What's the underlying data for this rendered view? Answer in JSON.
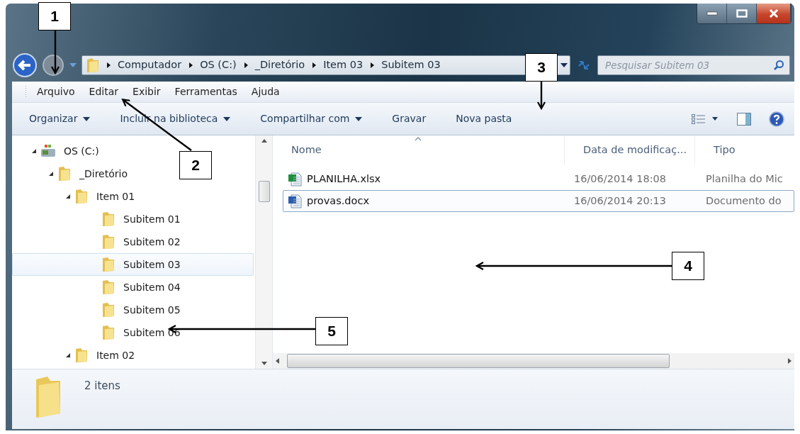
{
  "address_bar": {
    "breadcrumbs": [
      "Computador",
      "OS (C:)",
      "_Diretório",
      "Item 03",
      "Subitem 03"
    ]
  },
  "search": {
    "placeholder": "Pesquisar Subitem 03"
  },
  "menu": [
    {
      "label": "Arquivo"
    },
    {
      "label": "Editar"
    },
    {
      "label": "Exibir"
    },
    {
      "label": "Ferramentas"
    },
    {
      "label": "Ajuda"
    }
  ],
  "toolbar": [
    {
      "label": "Organizar",
      "dropdown": true
    },
    {
      "label": "Incluir na biblioteca",
      "dropdown": true
    },
    {
      "label": "Compartilhar com",
      "dropdown": true
    },
    {
      "label": "Gravar",
      "dropdown": false
    },
    {
      "label": "Nova pasta",
      "dropdown": false
    }
  ],
  "tree": [
    {
      "label": "OS (C:)",
      "kind": "drive",
      "expanded": true,
      "selected": false,
      "children": [
        {
          "label": "_Diretório",
          "kind": "folder",
          "expanded": true,
          "selected": false,
          "children": [
            {
              "label": "Item 01",
              "kind": "folder",
              "expanded": true,
              "selected": false,
              "children": [
                {
                  "label": "Subitem 01",
                  "kind": "folder",
                  "selected": false
                },
                {
                  "label": "Subitem 02",
                  "kind": "folder",
                  "selected": false
                },
                {
                  "label": "Subitem 03",
                  "kind": "folder",
                  "selected": true
                },
                {
                  "label": "Subitem 04",
                  "kind": "folder",
                  "selected": false
                },
                {
                  "label": "Subitem 05",
                  "kind": "folder",
                  "selected": false
                },
                {
                  "label": "Subitem 06",
                  "kind": "folder",
                  "selected": false
                }
              ]
            },
            {
              "label": "Item 02",
              "kind": "folder",
              "expanded": true,
              "selected": false
            }
          ]
        }
      ]
    }
  ],
  "file_list": {
    "columns": [
      "Nome",
      "Data de modificaç...",
      "Tipo"
    ],
    "rows": [
      {
        "kind": "spreadsheet",
        "name": "PLANILHA.xlsx",
        "date": "16/06/2014 18:08",
        "type": "Planilha do Mic",
        "selected": false
      },
      {
        "kind": "document",
        "name": "provas.docx",
        "date": "16/06/2014 20:13",
        "type": "Documento do",
        "selected": true
      }
    ]
  },
  "status": {
    "text": "2 itens"
  },
  "callouts": [
    {
      "label": "1"
    },
    {
      "label": "2"
    },
    {
      "label": "3"
    },
    {
      "label": "4"
    },
    {
      "label": "5"
    }
  ]
}
